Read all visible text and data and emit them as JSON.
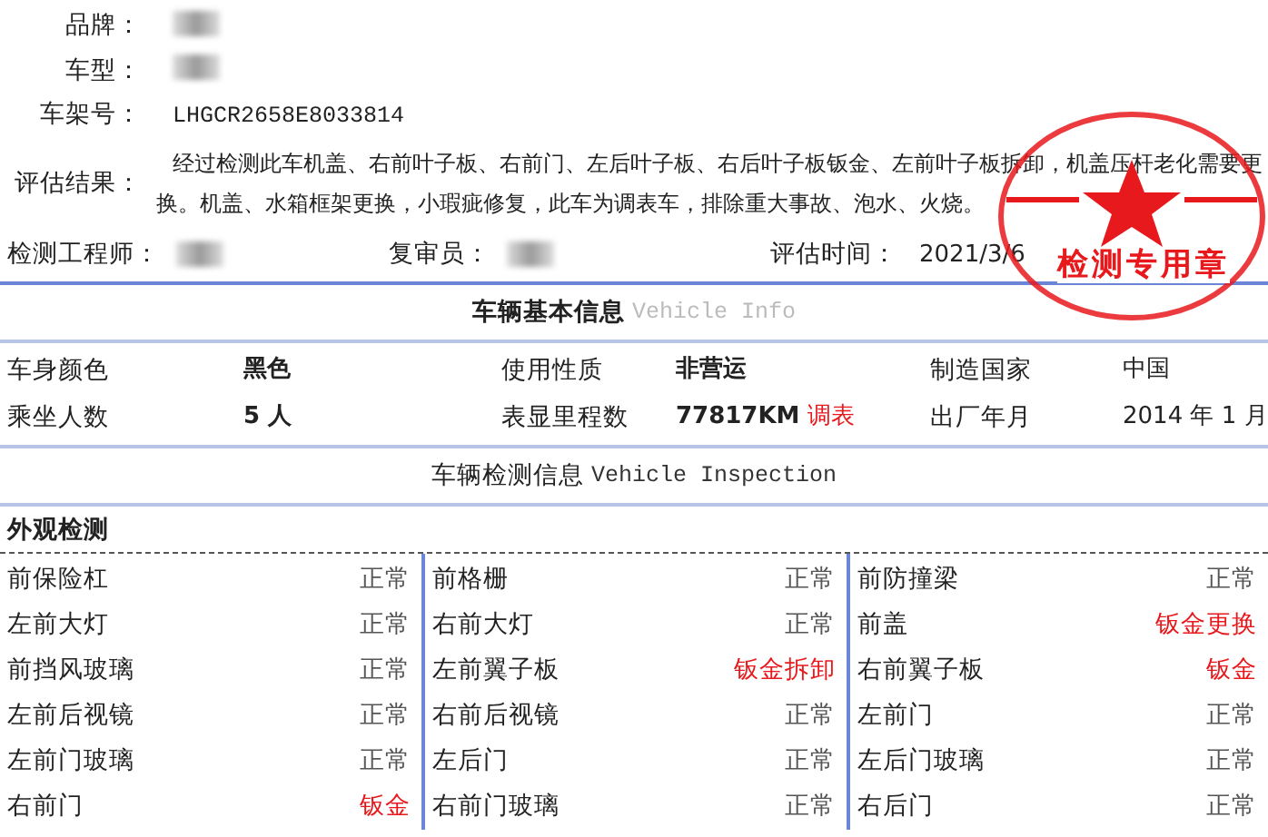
{
  "header_fields": [
    {
      "label": "品牌：",
      "kind": "redacted"
    },
    {
      "label": "车型：",
      "kind": "redacted"
    },
    {
      "label": "车架号：",
      "kind": "mono",
      "value": "LHGCR2658E8033814"
    },
    {
      "label": "评估结果：",
      "kind": "text",
      "value": "经过检测此车机盖、右前叶子板、右前门、左后叶子板、右后叶子板钣金、左前叶子板拆卸，机盖压杆老化需要更换。机盖、水箱框架更换，小瑕疵修复，此车为调表车，排除重大事故、泡水、火烧。"
    }
  ],
  "signatures": [
    {
      "label": "检测工程师：",
      "kind": "redacted"
    },
    {
      "label": "复审员：",
      "kind": "redacted"
    },
    {
      "label": "评估时间：",
      "kind": "text",
      "value": "2021/3/6"
    }
  ],
  "seal": {
    "text": "检测专用章"
  },
  "basic_info": {
    "title": "车辆基本信息",
    "title_en": "Vehicle Info",
    "rows": [
      [
        {
          "label": "车身颜色",
          "value": "黑色"
        },
        {
          "label": "使用性质",
          "value": "非营运"
        },
        {
          "label": "制造国家",
          "value": "中国"
        }
      ],
      [
        {
          "label": "乘坐人数",
          "value": "5 人"
        },
        {
          "label": "表显里程数",
          "value": "77817KM",
          "note": "调表"
        },
        {
          "label": "出厂年月",
          "value": "2014 年 1 月"
        }
      ]
    ]
  },
  "inspection": {
    "title": "车辆检测信息",
    "title_en": "Vehicle Inspection",
    "section": "外观检测",
    "columns": [
      [
        {
          "part": "前保险杠",
          "status": "正常",
          "alert": false
        },
        {
          "part": "左前大灯",
          "status": "正常",
          "alert": false
        },
        {
          "part": "前挡风玻璃",
          "status": "正常",
          "alert": false
        },
        {
          "part": "左前后视镜",
          "status": "正常",
          "alert": false
        },
        {
          "part": "左前门玻璃",
          "status": "正常",
          "alert": false
        },
        {
          "part": "右前门",
          "status": "钣金",
          "alert": true
        }
      ],
      [
        {
          "part": "前格栅",
          "status": "正常",
          "alert": false
        },
        {
          "part": "右前大灯",
          "status": "正常",
          "alert": false
        },
        {
          "part": "左前翼子板",
          "status": "钣金拆卸",
          "alert": true
        },
        {
          "part": "右前后视镜",
          "status": "正常",
          "alert": false
        },
        {
          "part": "左后门",
          "status": "正常",
          "alert": false
        },
        {
          "part": "右前门玻璃",
          "status": "正常",
          "alert": false
        }
      ],
      [
        {
          "part": "前防撞梁",
          "status": "正常",
          "alert": false
        },
        {
          "part": "前盖",
          "status": "钣金更换",
          "alert": true
        },
        {
          "part": "右前翼子板",
          "status": "钣金",
          "alert": true
        },
        {
          "part": "左前门",
          "status": "正常",
          "alert": false
        },
        {
          "part": "左后门玻璃",
          "status": "正常",
          "alert": false
        },
        {
          "part": "右后门",
          "status": "正常",
          "alert": false
        }
      ]
    ]
  }
}
